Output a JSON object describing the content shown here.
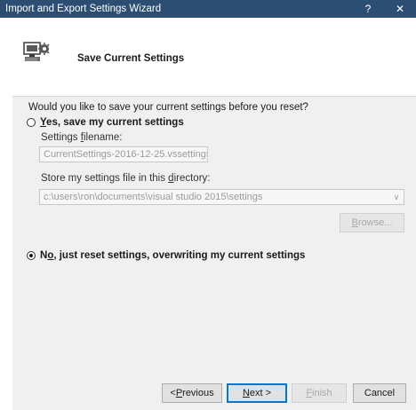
{
  "window": {
    "title": "Import and Export Settings Wizard",
    "help_glyph": "?",
    "close_glyph": "✕"
  },
  "header": {
    "title": "Save Current Settings"
  },
  "body": {
    "question": "Would you like to save your current settings before you reset?",
    "option_save": {
      "label_mnemonic": "Y",
      "label_rest": "es, save my current settings",
      "checked": false
    },
    "filename_label_pre": "Settings ",
    "filename_label_mnemonic": "f",
    "filename_label_post": "ilename:",
    "filename_value": "CurrentSettings-2016-12-25.vssettings",
    "directory_label_pre": "Store my settings file in this ",
    "directory_label_mnemonic": "d",
    "directory_label_post": "irectory:",
    "directory_value": "c:\\users\\ron\\documents\\visual studio 2015\\settings",
    "browse_mnemonic": "B",
    "browse_rest": "rowse...",
    "option_reset": {
      "label_pre": "N",
      "label_mnemonic": "o",
      "label_rest": ", just reset settings, overwriting my current settings",
      "checked": true
    }
  },
  "footer": {
    "previous_pre": "< ",
    "previous_mnemonic": "P",
    "previous_rest": "revious",
    "next_mnemonic": "N",
    "next_rest": "ext >",
    "finish_mnemonic": "F",
    "finish_rest": "inish",
    "cancel_label": "Cancel"
  },
  "colors": {
    "titlebar": "#2c4e72",
    "body_bg": "#f0f0f0",
    "accent": "#0078d7"
  }
}
